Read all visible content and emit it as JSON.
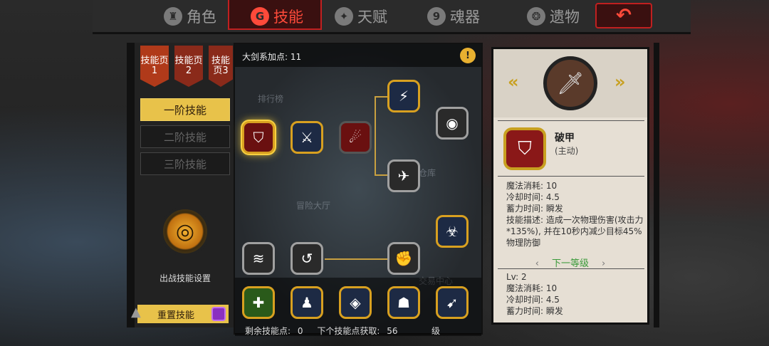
{
  "tabs": [
    {
      "label": "角色",
      "icon": "helmet-icon",
      "glyph": "♜"
    },
    {
      "label": "技能",
      "icon": "skill-icon",
      "glyph": "G"
    },
    {
      "label": "天赋",
      "icon": "talent-icon",
      "glyph": "✦"
    },
    {
      "label": "魂器",
      "icon": "soul-icon",
      "glyph": "9"
    },
    {
      "label": "遗物",
      "icon": "relic-icon",
      "glyph": "❂"
    }
  ],
  "back_glyph": "↶",
  "left": {
    "page_tabs": [
      "技能页1",
      "技能页2",
      "技能页3"
    ],
    "tiers": [
      "一阶技能",
      "二阶技能",
      "三阶技能"
    ],
    "battle_label": "出战技能设置",
    "reset_label": "重置技能"
  },
  "tree": {
    "header": "大剑系加点: 11",
    "map_labels": [
      "排行榜",
      "仓库",
      "冒险大厅",
      "交易中心"
    ],
    "remaining_label": "剩余技能点:",
    "remaining_value": "0",
    "next_label": "下个技能点获取:",
    "next_value": "56",
    "level_suffix": "级"
  },
  "detail": {
    "skill_name": "破甲",
    "skill_type": "(主动)",
    "current": {
      "mana": "魔法消耗: 10",
      "cooldown": "冷却时间: 4.5",
      "charge": "蓄力时间: 瞬发",
      "desc": "技能描述: 造成一次物理伤害(攻击力*135%), 并在10秒内减少目标45%物理防御"
    },
    "next_level_label": "下一等级",
    "next": {
      "level": "Lv: 2",
      "mana": "魔法消耗: 10",
      "cooldown": "冷却时间: 4.5",
      "charge": "蓄力时间: 瞬发"
    }
  },
  "colors": {
    "accent": "#ff4a3a",
    "gold": "#e8c24a",
    "panel": "#e6dfd4"
  }
}
